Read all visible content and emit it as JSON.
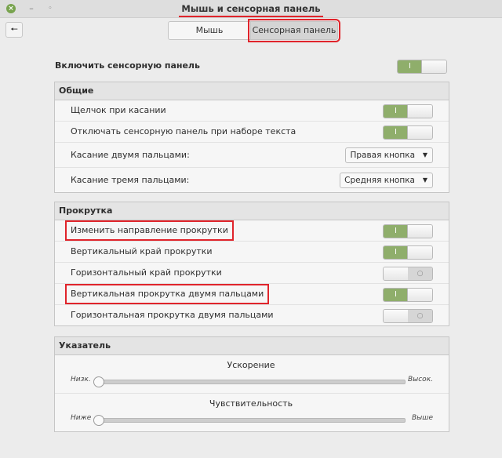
{
  "window": {
    "title": "Мышь и сенсорная панель"
  },
  "tabs": [
    {
      "label": "Мышь",
      "selected": false
    },
    {
      "label": "Сенсорная панель",
      "selected": true
    }
  ],
  "enable": {
    "label": "Включить сенсорную панель",
    "on": true
  },
  "general": {
    "header": "Общие",
    "rows": [
      {
        "label": "Щелчок при касании",
        "type": "switch",
        "on": true
      },
      {
        "label": "Отключать сенсорную панель при наборе текста",
        "type": "switch",
        "on": true
      },
      {
        "label": "Касание двумя пальцами:",
        "type": "dropdown",
        "value": "Правая кнопка"
      },
      {
        "label": "Касание тремя пальцами:",
        "type": "dropdown",
        "value": "Средняя кнопка"
      }
    ]
  },
  "scrolling": {
    "header": "Прокрутка",
    "rows": [
      {
        "label": "Изменить направление прокрутки",
        "on": true
      },
      {
        "label": "Вертикальный край прокрутки",
        "on": true
      },
      {
        "label": "Горизонтальный край прокрутки",
        "on": false
      },
      {
        "label": "Вертикальная прокрутка двумя пальцами",
        "on": true
      },
      {
        "label": "Горизонтальная прокрутка двумя пальцами",
        "on": false
      }
    ]
  },
  "pointer": {
    "header": "Указатель",
    "acceleration": {
      "title": "Ускорение",
      "min_label": "Низк.",
      "max_label": "Высок.",
      "value_fraction": 0.0
    },
    "sensitivity": {
      "title": "Чувствительность",
      "min_label": "Ниже",
      "max_label": "Выше",
      "value_fraction": 0.0
    }
  },
  "switch_text": {
    "on": "I",
    "off": "○"
  },
  "colors": {
    "accent_green": "#8fae6b",
    "highlight_red": "#e0242b"
  }
}
